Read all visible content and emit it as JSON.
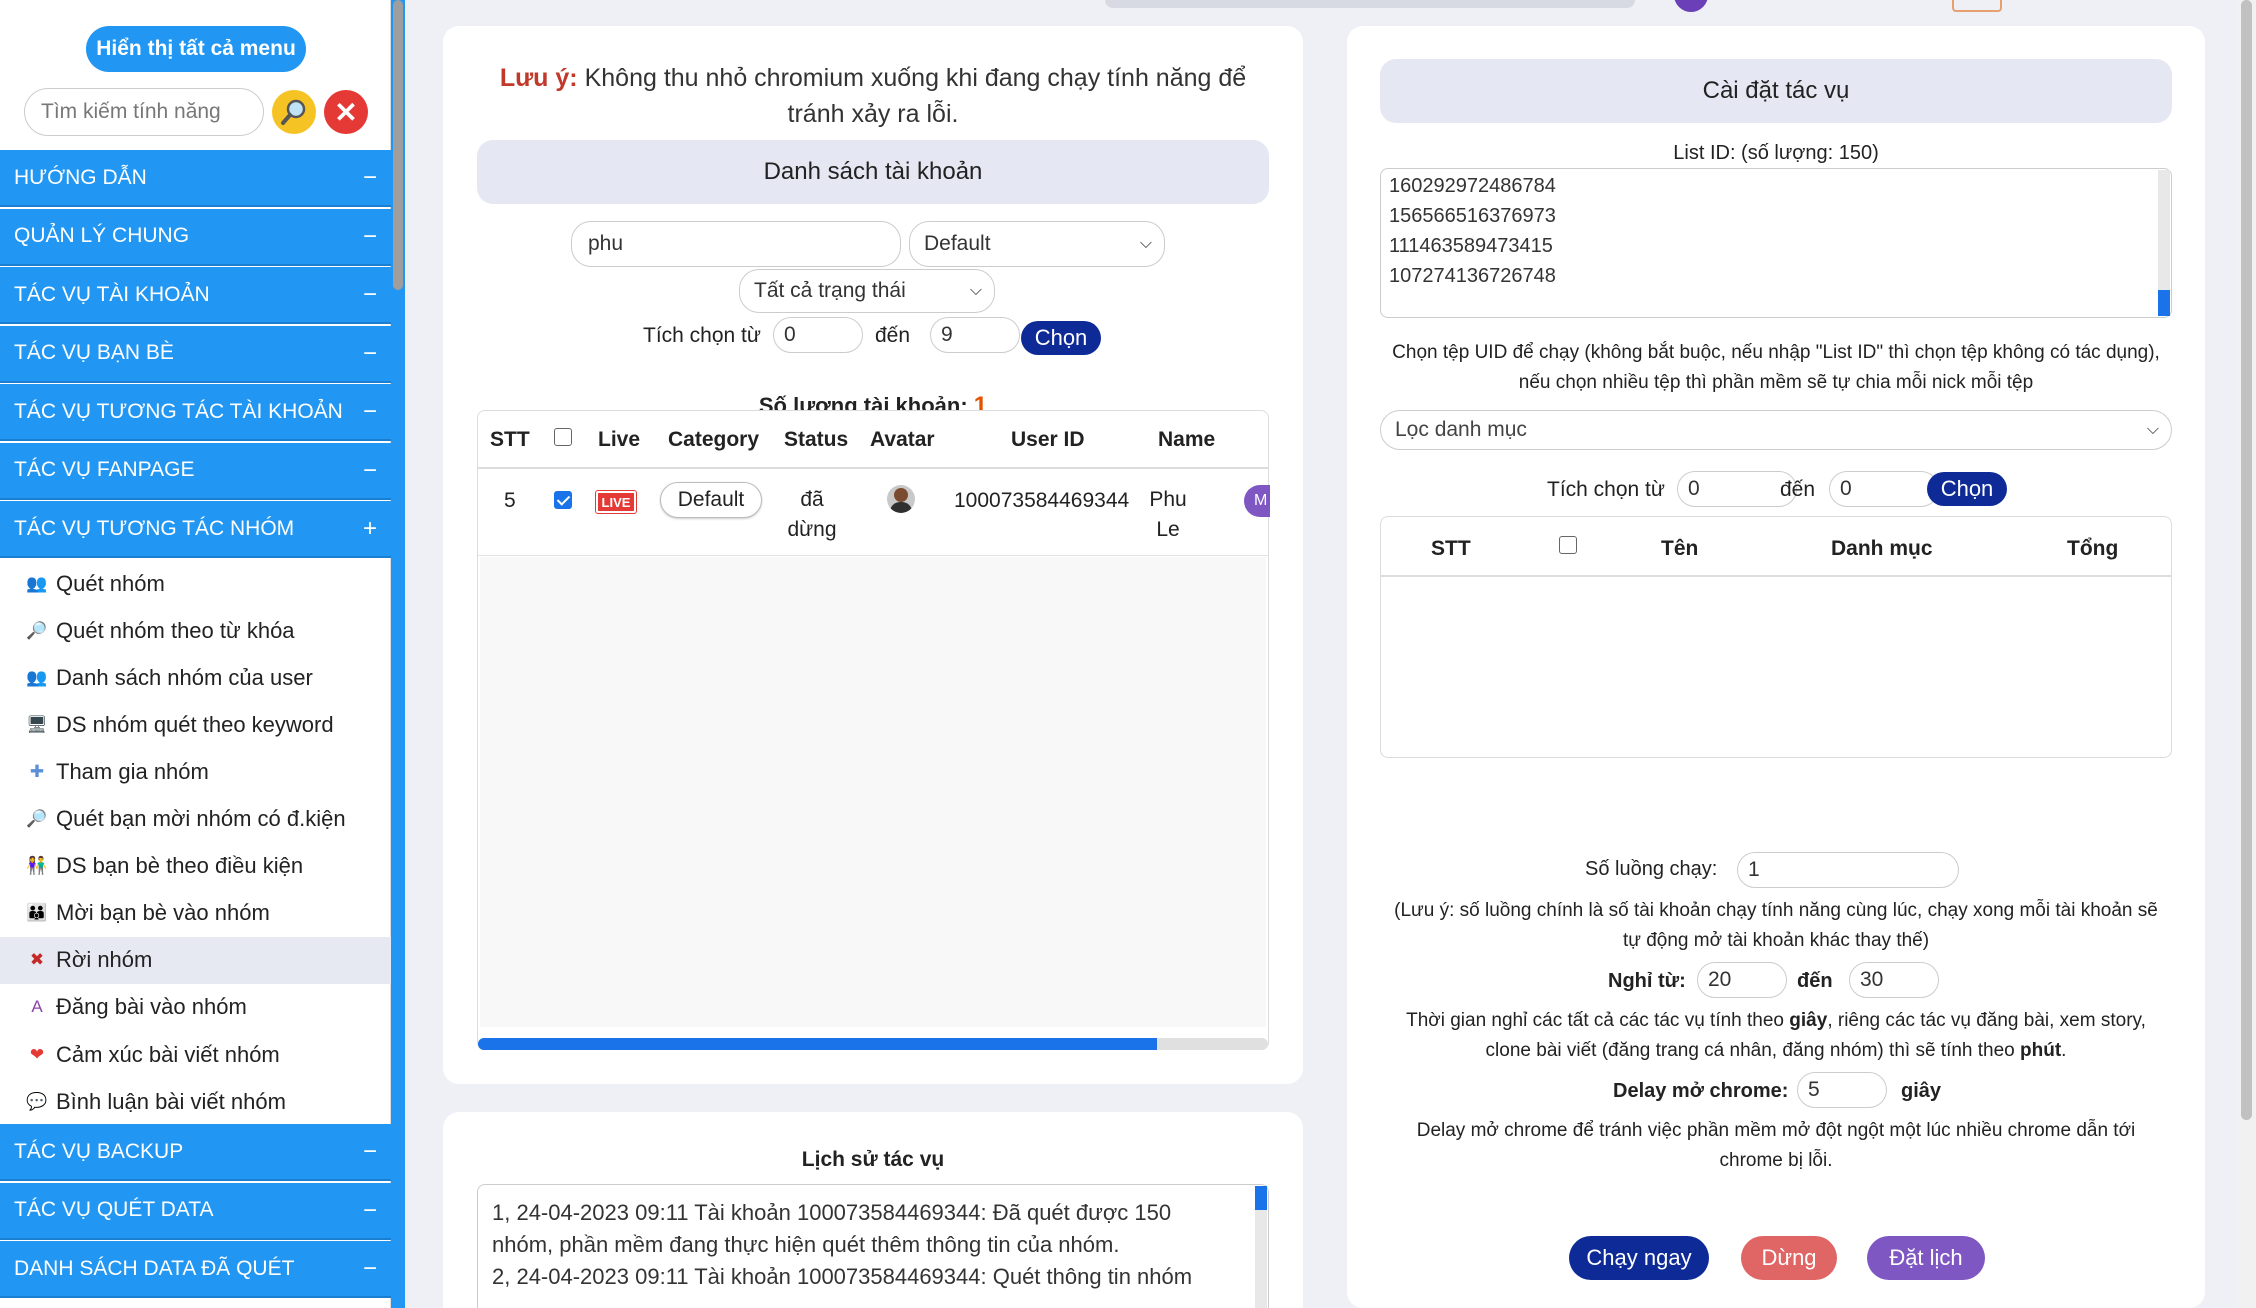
{
  "sidebar": {
    "show_all_label": "Hiển thị tất cả menu",
    "search_placeholder": "Tìm kiếm tính năng",
    "groups_top": [
      {
        "label": "HƯỚNG DẪN",
        "toggle": "−"
      },
      {
        "label": "QUẢN LÝ CHUNG",
        "toggle": "−"
      },
      {
        "label": "TÁC VỤ TÀI KHOẢN",
        "toggle": "−"
      },
      {
        "label": "TÁC VỤ BẠN BÈ",
        "toggle": "−"
      },
      {
        "label": "TÁC VỤ TƯƠNG TÁC TÀI KHOẢN",
        "toggle": "−"
      },
      {
        "label": "TÁC VỤ FANPAGE",
        "toggle": "−"
      },
      {
        "label": "TÁC VỤ TƯƠNG TÁC NHÓM",
        "toggle": "+"
      }
    ],
    "sub_items": [
      {
        "label": "Quét nhóm",
        "icon": "group-scan-icon",
        "glyph": "👥"
      },
      {
        "label": "Quét nhóm theo từ khóa",
        "icon": "magnifier-icon",
        "glyph": "🔎"
      },
      {
        "label": "Danh sách nhóm của user",
        "icon": "group-list-icon",
        "glyph": "👥"
      },
      {
        "label": "DS nhóm quét theo keyword",
        "icon": "monitor-icon",
        "glyph": "🖥"
      },
      {
        "label": "Tham gia nhóm",
        "icon": "join-icon",
        "glyph": "✚"
      },
      {
        "label": "Quét bạn mời nhóm có đ.kiện",
        "icon": "magnifier-icon",
        "glyph": "🔎"
      },
      {
        "label": "DS bạn bè theo điều kiện",
        "icon": "friends-icon",
        "glyph": "👫"
      },
      {
        "label": "Mời bạn bè vào nhóm",
        "icon": "invite-icon",
        "glyph": "👪"
      },
      {
        "label": "Rời nhóm",
        "icon": "leave-icon",
        "glyph": "✖"
      },
      {
        "label": "Đăng bài vào nhóm",
        "icon": "letter-a-icon",
        "glyph": "A"
      },
      {
        "label": "Cảm xúc bài viết nhóm",
        "icon": "heart-icon",
        "glyph": "❤"
      },
      {
        "label": "Bình luận bài viết nhóm",
        "icon": "comment-icon",
        "glyph": "💬"
      }
    ],
    "groups_bottom": [
      {
        "label": "TÁC VỤ BACKUP",
        "toggle": "−"
      },
      {
        "label": "TÁC VỤ QUÉT DATA",
        "toggle": "−"
      },
      {
        "label": "DANH SÁCH DATA ĐÃ QUÉT",
        "toggle": "−"
      }
    ]
  },
  "left_panel": {
    "note_prefix": "Lưu ý:",
    "note_line1": " Không thu nhỏ chromium xuống khi đang chạy tính năng để",
    "note_line2": "tránh xảy ra lỗi.",
    "header": "Danh sách tài khoản",
    "search_value": "phu",
    "category_selected": "Default",
    "status_selected": "Tất cả trạng thái",
    "range_label": "Tích chọn từ",
    "range_from": "0",
    "range_to_label": "đến",
    "range_to": "9",
    "select_btn": "Chọn",
    "count_label": "Số lượng tài khoản:",
    "count_value": "1",
    "columns": [
      "STT",
      "Live",
      "Category",
      "Status",
      "Avatar",
      "User ID",
      "Name"
    ],
    "row": {
      "stt": "5",
      "live": "LIVE",
      "category": "Default",
      "status_line1": "đã",
      "status_line2": "dừng",
      "user_id": "100073584469344",
      "name_line1": "Phu",
      "name_line2": "Le"
    },
    "horizontal_scroll_fraction": 0.86
  },
  "history": {
    "title": "Lịch sử tác vụ",
    "line1": "1, 24-04-2023 09:11 Tài khoản 100073584469344: Đã quét được 150",
    "line2": "nhóm, phần mềm đang thực hiện quét thêm thông tin của nhóm.",
    "line3": "2, 24-04-2023 09:11 Tài khoản 100073584469344: Quét thông tin nhóm"
  },
  "settings": {
    "header": "Cài đặt tác vụ",
    "list_id_label": "List ID: (số lượng: 150)",
    "list_ids": [
      "160292972486784",
      "156566516376973",
      "111463589473415",
      "107274136726748"
    ],
    "uid_help_line1": "Chọn tệp UID để chạy (không bắt buộc, nếu nhập \"List ID\" thì chọn tệp không có tác dụng),",
    "uid_help_line2": "nếu chọn nhiều tệp thì phần mềm sẽ tự chia mỗi nick mỗi tệp",
    "category_placeholder": "Lọc danh mục",
    "range_label": "Tích chọn từ",
    "range_from": "0",
    "range_to_label": "đến",
    "range_to": "0",
    "select_btn": "Chọn",
    "columns": [
      "STT",
      "Tên",
      "Danh mục",
      "Tổng"
    ],
    "threads_label": "Số luồng chạy:",
    "threads_value": "1",
    "threads_note_line1": "(Lưu ý: số luồng chính là số tài khoản chạy tính năng cùng lúc, chạy xong mỗi tài khoản sẽ",
    "threads_note_line2": "tự động mở tài khoản khác thay thế)",
    "rest_label": "Nghỉ từ:",
    "rest_from": "20",
    "rest_to_label": "đến",
    "rest_to": "30",
    "rest_note_line1_a": "Thời gian nghỉ các tất cả các tác vụ tính theo ",
    "rest_note_line1_b": "giây",
    "rest_note_line1_c": ", riêng các tác vụ đăng bài, xem story,",
    "rest_note_line2_a": "clone bài viết (đăng trang cá nhân, đăng nhóm) thì sẽ tính theo ",
    "rest_note_line2_b": "phút",
    "rest_note_line2_c": ".",
    "delay_label": "Delay mở chrome:",
    "delay_value": "5",
    "delay_unit": "giây",
    "delay_note_line1": "Delay mở chrome để tránh việc phần mềm mở đột ngột một lúc nhiều chrome dẫn tới",
    "delay_note_line2": "chrome bị lỗi.",
    "run_btn": "Chạy ngay",
    "stop_btn": "Dừng",
    "schedule_btn": "Đặt lịch"
  },
  "colors": {
    "primary": "#2196f3",
    "navy_button": "#0d2a96",
    "run_button": "#0d2a96",
    "stop_button": "#e06666",
    "schedule_button": "#7e57c2",
    "note_red": "#c0392b",
    "count_orange": "#e65100"
  }
}
